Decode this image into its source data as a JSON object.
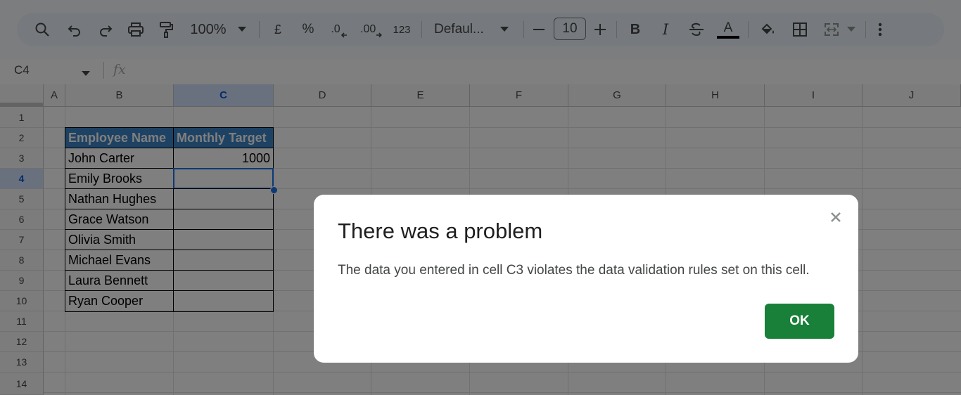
{
  "toolbar": {
    "zoom": "100%",
    "currency_label": "£",
    "percent_label": "%",
    "decimal_decrease_label": ".0",
    "decimal_increase_label": ".00",
    "number_format_label": "123",
    "font_name": "Defaul...",
    "font_size": "10",
    "bold_label": "B",
    "italic_label": "I",
    "text_color_label": "A",
    "text_color": "#000000"
  },
  "formula_bar": {
    "cell_reference": "C4",
    "fx_label": "fx"
  },
  "sheet": {
    "columns": [
      "A",
      "B",
      "C",
      "D",
      "E",
      "F",
      "G",
      "H",
      "I",
      "J"
    ],
    "rows": [
      "1",
      "2",
      "3",
      "4",
      "5",
      "6",
      "7",
      "8",
      "9",
      "10",
      "11",
      "12",
      "13",
      "14"
    ],
    "selected_column": "C",
    "selected_row": "4",
    "header_fill_color": "#3d85c6",
    "table": {
      "headers": [
        "Employee Name",
        "Monthly Target"
      ],
      "rows": [
        [
          "John Carter",
          "1000"
        ],
        [
          "Emily Brooks",
          ""
        ],
        [
          "Nathan Hughes",
          ""
        ],
        [
          "Grace Watson",
          ""
        ],
        [
          "Olivia Smith",
          ""
        ],
        [
          "Michael Evans",
          ""
        ],
        [
          "Laura Bennett",
          ""
        ],
        [
          "Ryan Cooper",
          ""
        ]
      ]
    }
  },
  "dialog": {
    "title": "There was a problem",
    "message": "The data you entered in cell C3 violates the data validation rules set on this cell.",
    "ok_label": "OK",
    "ok_color": "#188038"
  }
}
